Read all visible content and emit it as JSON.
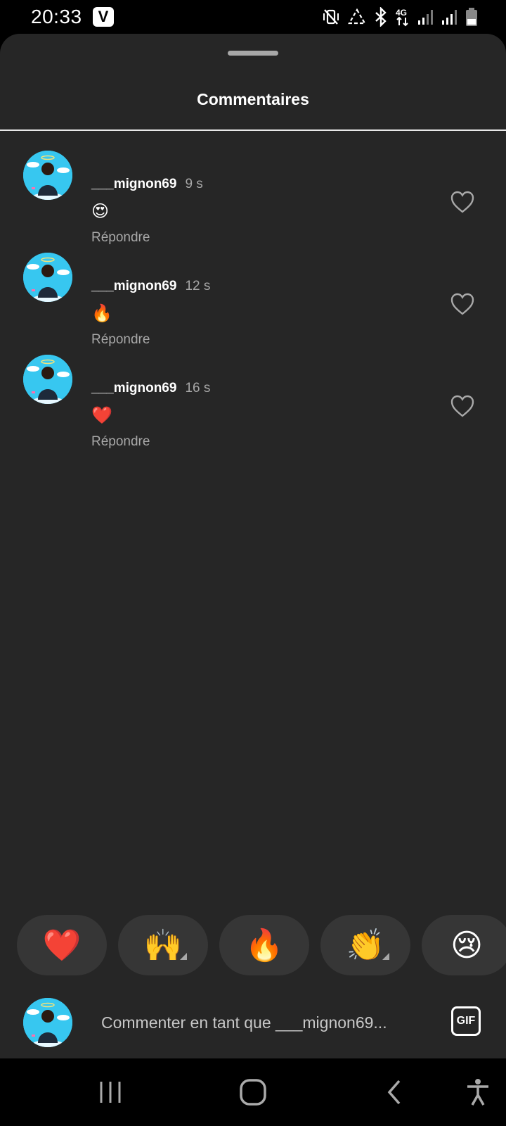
{
  "status_bar": {
    "time": "20:33",
    "app_badge": "V",
    "icons": [
      "vibrate-mute-icon",
      "data-saver-icon",
      "bluetooth-icon",
      "4g-icon",
      "signal-icon",
      "signal-icon",
      "battery-icon"
    ],
    "network_label": "4G"
  },
  "sheet": {
    "title": "Commentaires"
  },
  "comments": [
    {
      "username": "___mignon69",
      "time": "9 s",
      "text": "😍",
      "reply_label": "Répondre",
      "like_icon": "heart-outline-icon"
    },
    {
      "username": "___mignon69",
      "time": "12 s",
      "text": "🔥",
      "reply_label": "Répondre",
      "like_icon": "heart-outline-icon"
    },
    {
      "username": "___mignon69",
      "time": "16 s",
      "text": "❤️",
      "reply_label": "Répondre",
      "like_icon": "heart-outline-icon"
    }
  ],
  "reactions": [
    "❤️",
    "🙌",
    "🔥",
    "👏",
    "😢"
  ],
  "composer": {
    "placeholder": "Commenter en tant que ___mignon69...",
    "gif_label": "GIF"
  },
  "nav": [
    "recents-icon",
    "home-icon",
    "back-icon",
    "accessibility-icon"
  ],
  "colors": {
    "sheet_bg": "#262626",
    "secondary_text": "#a8a8a8",
    "avatar_sky": "#37c7f0"
  }
}
